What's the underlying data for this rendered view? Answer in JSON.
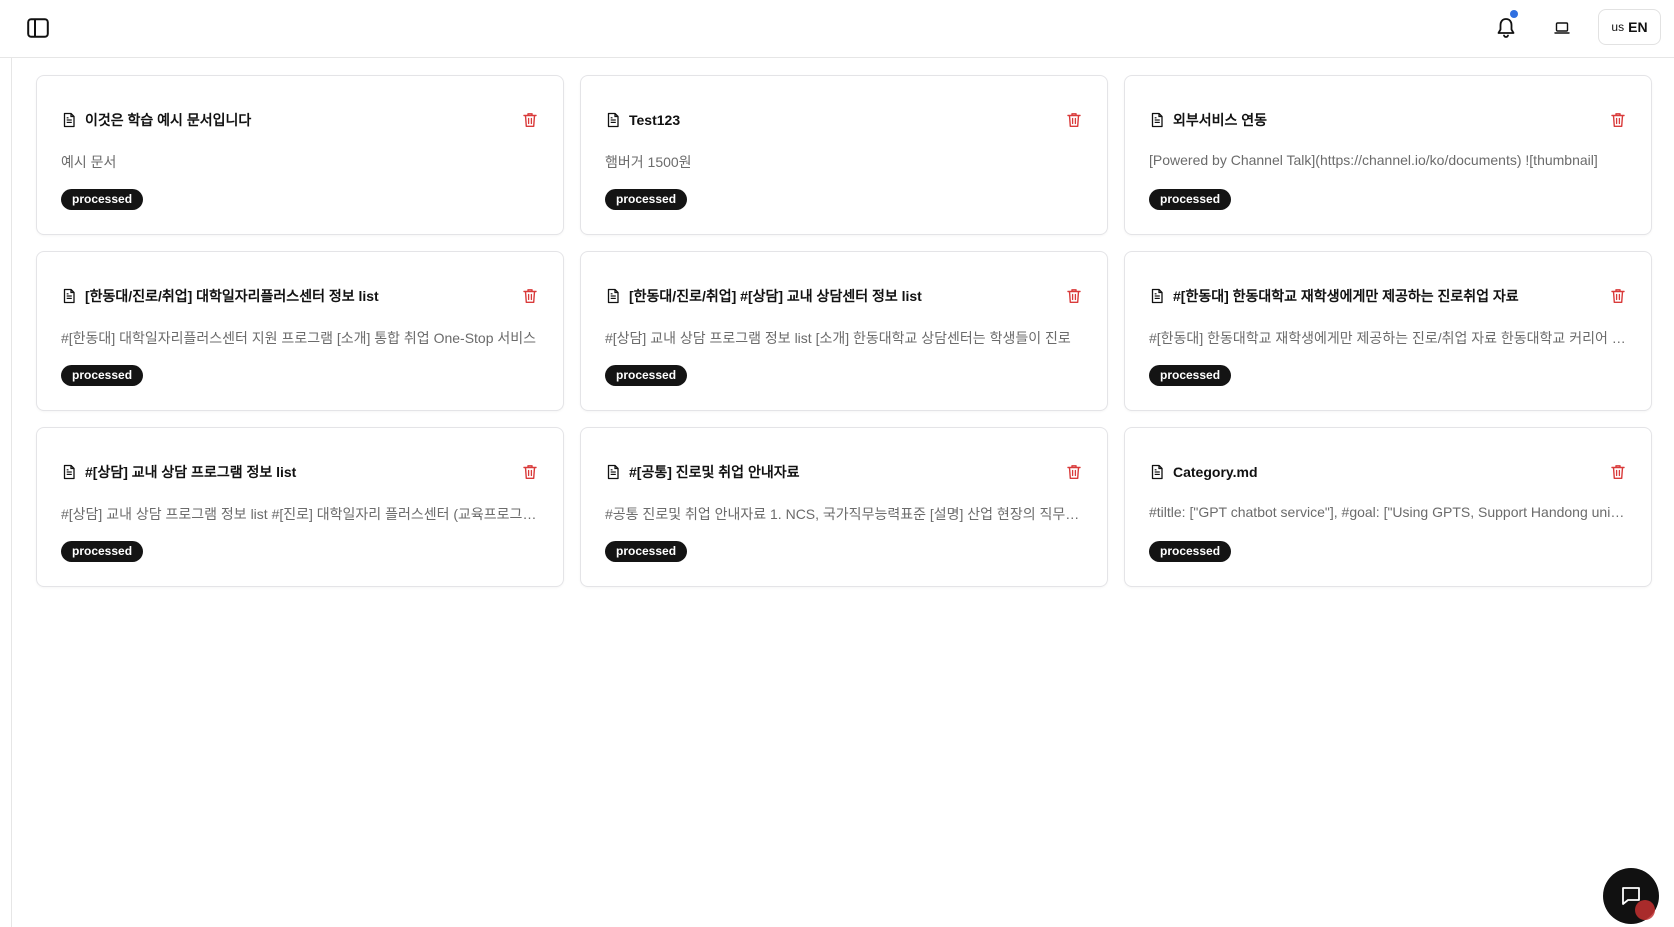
{
  "header": {
    "icons": [
      "sidebar-toggle-icon",
      "bell-icon",
      "laptop-icon"
    ],
    "lang_flag": "us",
    "lang_label": "EN",
    "notification_dot_color": "#2f6fe0"
  },
  "documents": [
    {
      "title": "이것은 학습 예시 문서입니다",
      "description": "예시 문서",
      "status": "processed"
    },
    {
      "title": "Test123",
      "description": "햄버거 1500원",
      "status": "processed"
    },
    {
      "title": "외부서비스 연동",
      "description": "[Powered by Channel Talk](https://channel.io/ko/documents) ![thumbnail]",
      "status": "processed"
    },
    {
      "title": "[한동대/진로/취업] 대학일자리플러스센터 정보 list",
      "description": "#[한동대] 대학일자리플러스센터 지원 프로그램 [소개] 통합 취업 One-Stop 서비스",
      "status": "processed"
    },
    {
      "title": "[한동대/진로/취업] #[상담] 교내 상담센터 정보 list",
      "description": "#[상담] 교내 상담 프로그램 정보 list [소개] 한동대학교 상담센터는 학생들이 진로",
      "status": "processed"
    },
    {
      "title": "#[한동대] 한동대학교 재학생에게만 제공하는 진로취업 자료",
      "description": "#[한동대] 한동대학교 재학생에게만 제공하는 진로/취업 자료 한동대학교 커리어 센터",
      "status": "processed"
    },
    {
      "title": "#[상담] 교내 상담 프로그램 정보 list",
      "description": "#[상담] 교내 상담 프로그램 정보 list #[진로] 대학일자리 플러스센터 (교육프로그램)",
      "status": "processed"
    },
    {
      "title": "#[공통] 진로및 취업 안내자료",
      "description": "#공통 진로및 취업 안내자료 1. NCS, 국가직무능력표준 [설명] 산업 현장의 직무를 수행",
      "status": "processed"
    },
    {
      "title": "Category.md",
      "description": "#tiltle: [\"GPT chatbot service\"], #goal: [\"Using GPTS, Support Handong university\"]",
      "status": "processed"
    }
  ],
  "colors": {
    "badge_bg": "#141414",
    "trash_icon": "#d93a3a",
    "description_text": "#6b6b6b"
  },
  "chat_widget": {
    "icon": "chat-icon"
  }
}
